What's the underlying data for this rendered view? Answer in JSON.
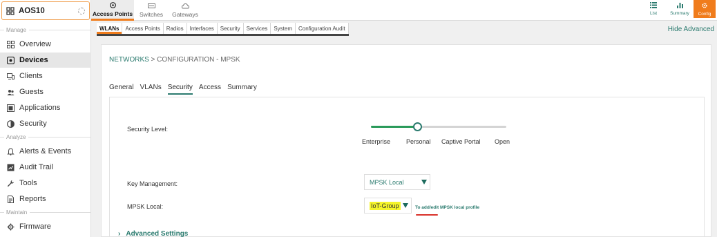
{
  "group": {
    "name": "AOS10"
  },
  "sidebar": {
    "sections": {
      "manage": "Manage",
      "analyze": "Analyze",
      "maintain": "Maintain"
    },
    "items": [
      {
        "label": "Overview",
        "icon": "grid-icon"
      },
      {
        "label": "Devices",
        "icon": "devices-icon"
      },
      {
        "label": "Clients",
        "icon": "clients-icon"
      },
      {
        "label": "Guests",
        "icon": "guests-icon"
      },
      {
        "label": "Applications",
        "icon": "applications-icon"
      },
      {
        "label": "Security",
        "icon": "shield-icon"
      },
      {
        "label": "Alerts & Events",
        "icon": "bell-icon"
      },
      {
        "label": "Audit Trail",
        "icon": "audit-icon"
      },
      {
        "label": "Tools",
        "icon": "wrench-icon"
      },
      {
        "label": "Reports",
        "icon": "reports-icon"
      },
      {
        "label": "Firmware",
        "icon": "firmware-icon"
      }
    ]
  },
  "topbar": {
    "tabs": [
      {
        "label": "Access Points",
        "icon": "access-point-icon"
      },
      {
        "label": "Switches",
        "icon": "switch-icon"
      },
      {
        "label": "Gateways",
        "icon": "gateway-icon"
      }
    ],
    "right": [
      {
        "label": "List",
        "icon": "list-icon"
      },
      {
        "label": "Summary",
        "icon": "bar-chart-icon"
      },
      {
        "label": "Config",
        "icon": "gear-icon"
      }
    ]
  },
  "subtabs": [
    "WLANs",
    "Access Points",
    "Radios",
    "Interfaces",
    "Security",
    "Services",
    "System",
    "Configuration Audit"
  ],
  "hide_advanced": "Hide Advanced",
  "breadcrumb": {
    "link": "NETWORKS",
    "rest": " > CONFIGURATION - MPSK"
  },
  "form_tabs": [
    "General",
    "VLANs",
    "Security",
    "Access",
    "Summary"
  ],
  "security": {
    "level_label": "Security Level:",
    "levels": [
      "Enterprise",
      "Personal",
      "Captive Portal",
      "Open"
    ],
    "selected_level": "Personal",
    "slider_position": 0.34
  },
  "key_management": {
    "label": "Key Management:",
    "value": "MPSK Local"
  },
  "mpsk_local": {
    "label": "MPSK Local:",
    "value": "IoT-Group",
    "note": "To add/edit MPSK local profile"
  },
  "advanced_settings": "Advanced Settings",
  "colors": {
    "accent": "#2a7a6e",
    "brand": "#f07c1c",
    "slider_fill": "#2a9a5a",
    "highlight": "#f5f52a",
    "annotation": "#d9312a"
  }
}
